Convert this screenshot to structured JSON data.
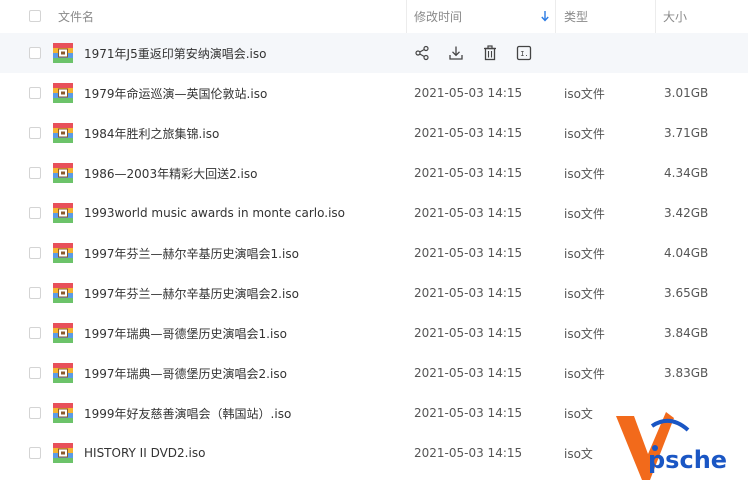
{
  "header": {
    "name": "文件名",
    "modified": "修改时间",
    "type": "类型",
    "size": "大小"
  },
  "files": [
    {
      "name": "1971年J5重返印第安纳演唱会.iso",
      "time": "",
      "type": "",
      "size": ""
    },
    {
      "name": "1979年命运巡演—英国伦敦站.iso",
      "time": "2021-05-03 14:15",
      "type": "iso文件",
      "size": "3.01GB"
    },
    {
      "name": "1984年胜利之旅集锦.iso",
      "time": "2021-05-03 14:15",
      "type": "iso文件",
      "size": "3.71GB"
    },
    {
      "name": "1986—2003年精彩大回送2.iso",
      "time": "2021-05-03 14:15",
      "type": "iso文件",
      "size": "4.34GB"
    },
    {
      "name": "1993world music awards in monte carlo.iso",
      "time": "2021-05-03 14:15",
      "type": "iso文件",
      "size": "3.42GB"
    },
    {
      "name": "1997年芬兰—赫尔辛基历史演唱会1.iso",
      "time": "2021-05-03 14:15",
      "type": "iso文件",
      "size": "4.04GB"
    },
    {
      "name": "1997年芬兰—赫尔辛基历史演唱会2.iso",
      "time": "2021-05-03 14:15",
      "type": "iso文件",
      "size": "3.65GB"
    },
    {
      "name": "1997年瑞典—哥德堡历史演唱会1.iso",
      "time": "2021-05-03 14:15",
      "type": "iso文件",
      "size": "3.84GB"
    },
    {
      "name": "1997年瑞典—哥德堡历史演唱会2.iso",
      "time": "2021-05-03 14:15",
      "type": "iso文件",
      "size": "3.83GB"
    },
    {
      "name": "1999年好友慈善演唱会（韩国站）.iso",
      "time": "2021-05-03 14:15",
      "type": "iso文",
      "size": ""
    },
    {
      "name": "HISTORY II DVD2.iso",
      "time": "2021-05-03 14:15",
      "type": "iso文",
      "size": ""
    }
  ],
  "row_actions": [
    "share-icon",
    "download-icon",
    "delete-icon",
    "rename-icon"
  ],
  "watermark": {
    "text": "psche"
  },
  "colors": {
    "accent": "#2b7be4",
    "hover_row": "#f5f7fa",
    "watermark_orange": "#f26a1b",
    "watermark_blue": "#1a56c4"
  }
}
